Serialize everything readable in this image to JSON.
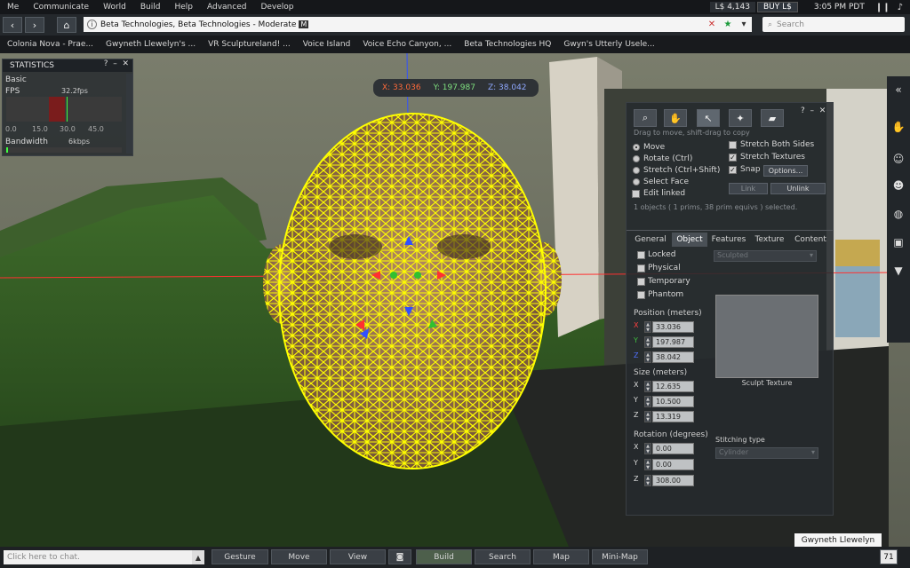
{
  "menubar": {
    "items": [
      "Me",
      "Communicate",
      "World",
      "Build",
      "Help",
      "Advanced",
      "Develop"
    ],
    "balance": "L$ 4,143",
    "buy_label": "BUY L$",
    "clock": "3:05 PM PDT"
  },
  "navbar": {
    "location": "Beta Technologies, Beta Technologies - Moderate",
    "maturity_badge": "M",
    "search_placeholder": "Search"
  },
  "favorites": [
    "Colonia Nova - Prae...",
    "Gwyneth Llewelyn's ...",
    "VR Sculptureland! ...",
    "Voice Island",
    "Voice Echo Canyon, ...",
    "Beta Technologies HQ",
    "Gwyn's Utterly Usele..."
  ],
  "statistics": {
    "title": "STATISTICS",
    "section": "Basic",
    "fps_label": "FPS",
    "fps_value": "32.2fps",
    "ticks": [
      "0.0",
      "15.0",
      "30.0",
      "45.0"
    ],
    "bandwidth_label": "Bandwidth",
    "bandwidth_value": "6kbps"
  },
  "coords": {
    "x": "X: 33.036",
    "y": "Y: 197.987",
    "z": "Z: 38.042"
  },
  "tools": {
    "hint": "Drag to move, shift-drag to copy",
    "modes": [
      "Move",
      "Rotate (Ctrl)",
      "Stretch (Ctrl+Shift)",
      "Select Face"
    ],
    "edit_linked": "Edit linked",
    "stretch_both": "Stretch Both Sides",
    "stretch_textures": "Stretch Textures",
    "snap": "Snap",
    "options": "Options...",
    "link": "Link",
    "unlink": "Unlink",
    "selected_info": "1 objects ( 1 prims, 38 prim equivs ) selected.",
    "tabs": [
      "General",
      "Object",
      "Features",
      "Texture",
      "Content"
    ],
    "flags": [
      "Locked",
      "Physical",
      "Temporary",
      "Phantom"
    ],
    "prim_type": "Sculpted",
    "position_label": "Position (meters)",
    "position": [
      "33.036",
      "197.987",
      "38.042"
    ],
    "size_label": "Size (meters)",
    "size": [
      "12.635",
      "10.500",
      "13.319"
    ],
    "rotation_label": "Rotation (degrees)",
    "rotation": [
      "0.00",
      "0.00",
      "308.00"
    ],
    "sculpt_texture": "Sculpt Texture",
    "stitching_label": "Stitching type",
    "stitching_value": "Cylinder"
  },
  "bottombar": {
    "chat_placeholder": "Click here to chat.",
    "buttons": [
      "Gesture",
      "Move",
      "View",
      "Build",
      "Search",
      "Map",
      "Mini-Map"
    ],
    "counter": "71"
  },
  "avatar_name": "Gwyneth Llewelyn",
  "colors": {
    "wireframe": "#ffff00",
    "axis_x": "#ff3030",
    "axis_y": "#30c030",
    "axis_z": "#3050ff"
  }
}
